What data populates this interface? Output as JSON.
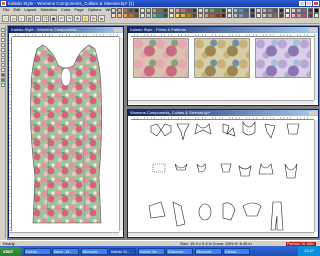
{
  "app": {
    "title": "Kaledo Style - Womens Components_Collars & Sleeves.kp* [1]",
    "menu": [
      "File",
      "Edit",
      "Layout",
      "Selection",
      "Color",
      "Page",
      "Options",
      "Window",
      "?"
    ]
  },
  "palette": [
    "#e8d3c9",
    "#c9a58d",
    "#9c7a63",
    "#6b4a38",
    "#3e2a1f",
    "#f2e2a2",
    "#e0c266",
    "#c9a33a",
    "#8f6f1e",
    "#51400f",
    "#f5cfd6",
    "#e89aab",
    "#d4607c",
    "#a63654",
    "#6b1832",
    "#cfe4c8",
    "#9ccf8f",
    "#5fae56",
    "#337d30",
    "#174d17",
    "#cfe0ef",
    "#92bfe3",
    "#4f8dcc",
    "#2b5b9a",
    "#142e5a",
    "#e3d4ec",
    "#c1a5d8",
    "#9472be",
    "#663f94",
    "#3b1f5d",
    "#ffffff",
    "#d9d9d9",
    "#a6a6a6",
    "#737373",
    "#404040",
    "#000000",
    "#f7e3c7",
    "#f0c28f",
    "#e39d57",
    "#c97426",
    "#8f4b12",
    "#d6f0ee",
    "#9fdcd4",
    "#5cbfb4",
    "#2e8e85",
    "#145c55",
    "#fbf0b0",
    "#f4de6a",
    "#e0bd2a",
    "#a68510",
    "#5f4b08",
    "#f2c7c0",
    "#e08d80",
    "#c7544a",
    "#953229",
    "#5c1712",
    "#e0e6f2",
    "#b5c2dd",
    "#8497c4",
    "#52659c",
    "#263a68",
    "#ece6dc",
    "#d7cbb6",
    "#b3a284",
    "#857358",
    "#4d412f",
    "#fde6ef",
    "#f6b6cd",
    "#ea7ea7",
    "#c94679",
    "#8a2148",
    "#e4f2d2"
  ],
  "windows": {
    "garment": {
      "title": "Kaledo Style - Womens Components..."
    },
    "swatches": {
      "title": "Kaledo Style - Prints & Patterns",
      "colors": [
        [
          "#e8a7b3",
          "#c96b7e",
          "#d9c4b1",
          "#7fa37a"
        ],
        [
          "#c7b27a",
          "#9c8552",
          "#d6cfa8",
          "#6f8fa8"
        ],
        [
          "#b8a6d4",
          "#8c76b3",
          "#d9cfe8",
          "#a5bfdc"
        ]
      ]
    },
    "components": {
      "title": "Womens Components_Collars & Sleeves.kp*"
    }
  },
  "status": {
    "left": "Ready",
    "right": "Size: 15.3 x 9.3 in  Zoom: 33%  H: 6.40 in",
    "color": "Pantone 18-1664"
  },
  "taskbar": {
    "start": "start",
    "tasks": [
      "Kaledo...",
      "Inbox - M...",
      "Microsoft...",
      "Kaledo St...",
      "Kaledo Vie...",
      "Documen...",
      "Microsoft...",
      "Kaledo..."
    ],
    "clock": "12:47"
  }
}
